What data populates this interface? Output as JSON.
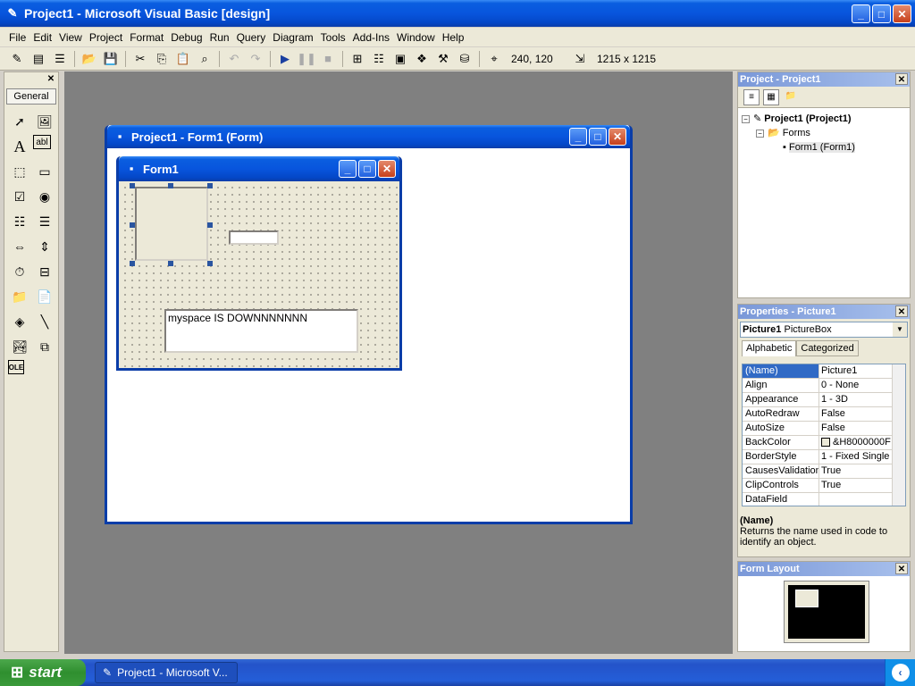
{
  "window": {
    "title": "Project1 - Microsoft Visual Basic [design]"
  },
  "menu": [
    "File",
    "Edit",
    "View",
    "Project",
    "Format",
    "Debug",
    "Run",
    "Query",
    "Diagram",
    "Tools",
    "Add-Ins",
    "Window",
    "Help"
  ],
  "toolbar": {
    "position": "240, 120",
    "size": "1215 x 1215"
  },
  "toolbox": {
    "tab": "General"
  },
  "designer": {
    "title": "Project1 - Form1 (Form)"
  },
  "form": {
    "title": "Form1",
    "label_text": "myspace IS DOWNNNNNNN"
  },
  "project_explorer": {
    "title": "Project - Project1",
    "project": "Project1 (Project1)",
    "folder": "Forms",
    "form": "Form1 (Form1)"
  },
  "properties": {
    "title": "Properties - Picture1",
    "object_name": "Picture1",
    "object_type": "PictureBox",
    "tab_alpha": "Alphabetic",
    "tab_cat": "Categorized",
    "rows": [
      {
        "name": "(Name)",
        "value": "Picture1"
      },
      {
        "name": "Align",
        "value": "0 - None"
      },
      {
        "name": "Appearance",
        "value": "1 - 3D"
      },
      {
        "name": "AutoRedraw",
        "value": "False"
      },
      {
        "name": "AutoSize",
        "value": "False"
      },
      {
        "name": "BackColor",
        "value": "&H8000000F"
      },
      {
        "name": "BorderStyle",
        "value": "1 - Fixed Single"
      },
      {
        "name": "CausesValidation",
        "value": "True"
      },
      {
        "name": "ClipControls",
        "value": "True"
      },
      {
        "name": "DataField",
        "value": ""
      }
    ],
    "desc_title": "(Name)",
    "desc_text": "Returns the name used in code to identify an object."
  },
  "form_layout": {
    "title": "Form Layout"
  },
  "taskbar": {
    "start": "start",
    "task": "Project1 - Microsoft V..."
  },
  "colors": {
    "title_blue": "#0855dd",
    "mdi_gray": "#808080",
    "selection": "#316ac5"
  }
}
